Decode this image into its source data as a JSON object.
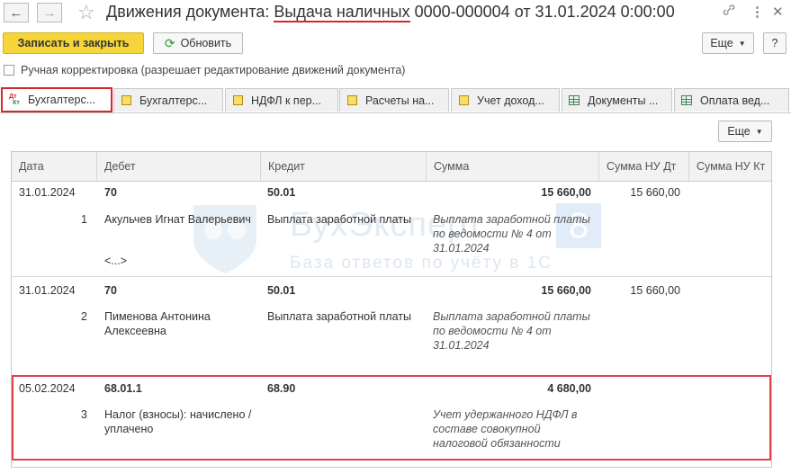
{
  "window": {
    "title_prefix": "Движения документа: ",
    "title_doc": "Выдача наличных",
    "title_suffix": " 0000-000004 от 31.01.2024 0:00:00",
    "nav_back": "←",
    "nav_forward": "→",
    "star": "☆",
    "link": "🔗",
    "more": "⋮",
    "close": "✕"
  },
  "toolbar": {
    "save_close": "Записать и закрыть",
    "refresh": "Обновить",
    "refresh_icon": "⟳",
    "more": "Еще",
    "help": "?"
  },
  "manual_correction": {
    "label": "Ручная корректировка (разрешает редактирование движений документа)",
    "checked": false
  },
  "tabs": [
    {
      "label": "Бухгалтерс...",
      "icon": "dt-kt-icon",
      "active": true
    },
    {
      "label": "Бухгалтерс...",
      "icon": "register-icon",
      "active": false
    },
    {
      "label": "НДФЛ к пер...",
      "icon": "register-icon",
      "active": false
    },
    {
      "label": "Расчеты на...",
      "icon": "register-icon",
      "active": false
    },
    {
      "label": "Учет доход...",
      "icon": "register-icon",
      "active": false
    },
    {
      "label": "Документы ...",
      "icon": "table-icon",
      "active": false
    },
    {
      "label": "Оплата вед...",
      "icon": "table-icon",
      "active": false
    }
  ],
  "table_more": "Еще",
  "columns": [
    "Дата",
    "Дебет",
    "Кредит",
    "Сумма",
    "Сумма НУ Дт",
    "Сумма НУ Кт"
  ],
  "rows": [
    {
      "date": "31.01.2024",
      "n": "1",
      "debit": "70",
      "debit_sub": "Акульчев Игнат Валерьевич",
      "debit_more": "<...>",
      "credit": "50.01",
      "credit_sub": "Выплата заработной платы",
      "sum": "15 660,00",
      "content": "Выплата заработной платы по ведомости № 4 от 31.01.2024",
      "nu_dt": "15 660,00",
      "nu_kt": ""
    },
    {
      "date": "31.01.2024",
      "n": "2",
      "debit": "70",
      "debit_sub": "Пименова Антонина Алексеевна",
      "debit_more": "",
      "credit": "50.01",
      "credit_sub": "Выплата заработной платы",
      "sum": "15 660,00",
      "content": "Выплата заработной платы по ведомости № 4 от 31.01.2024",
      "nu_dt": "15 660,00",
      "nu_kt": ""
    },
    {
      "date": "05.02.2024",
      "n": "3",
      "debit": "68.01.1",
      "debit_sub": "Налог (взносы): начислено / уплачено",
      "debit_more": "",
      "credit": "68.90",
      "credit_sub": "",
      "sum": "4 680,00",
      "content": "Учет удержанного НДФЛ в составе совокупной налоговой обязанности",
      "nu_dt": "",
      "nu_kt": ""
    }
  ],
  "watermark": {
    "brand": "БухЭксперт",
    "badge": "8",
    "tagline": "База ответов по учёту в 1С"
  }
}
